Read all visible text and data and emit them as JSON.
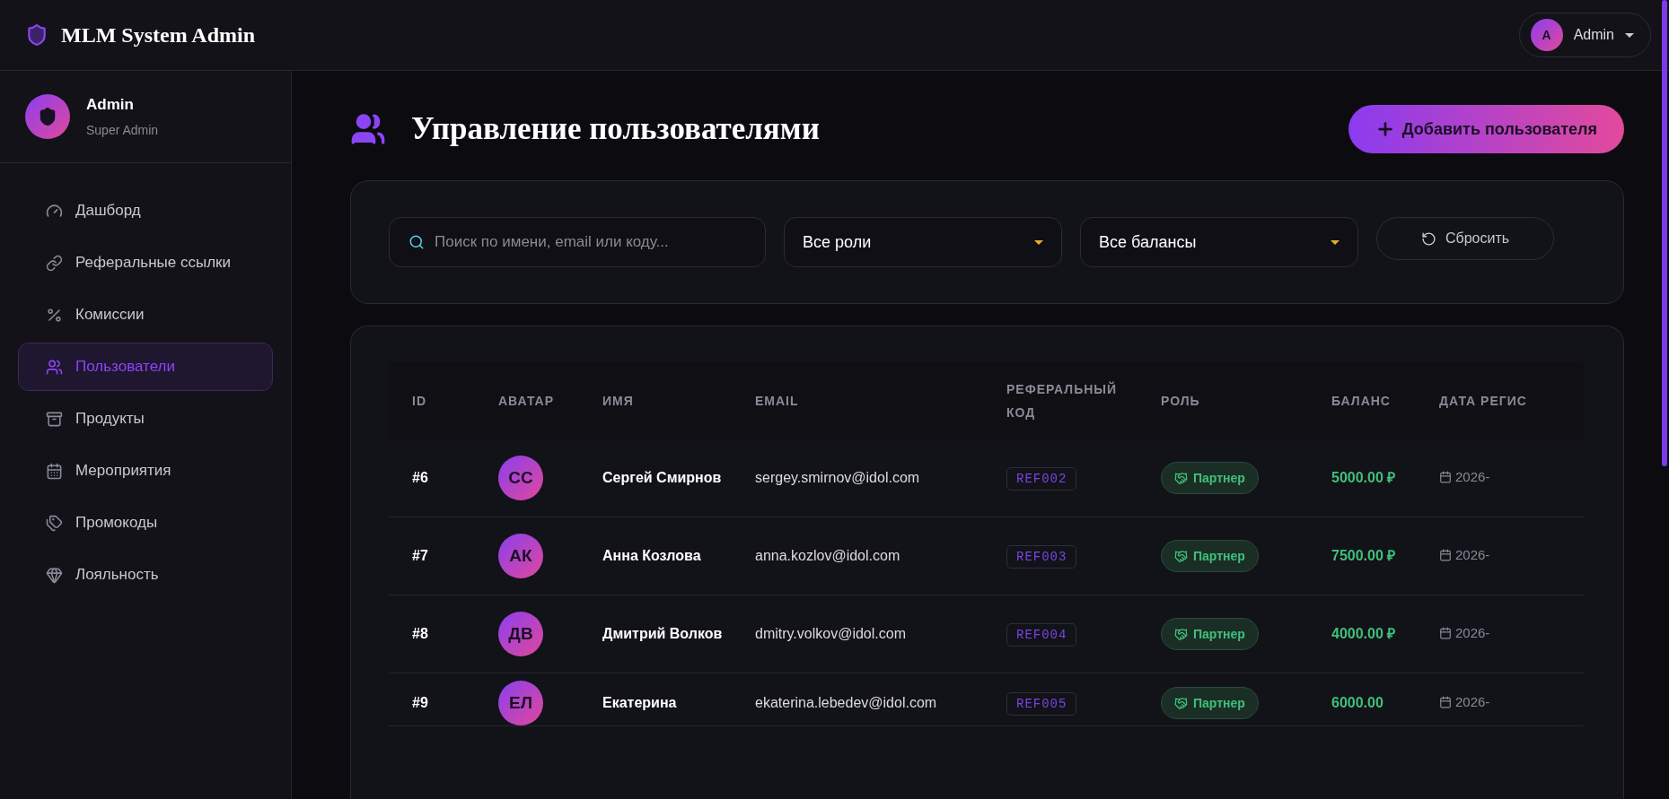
{
  "header": {
    "title": "MLM System Admin",
    "user_initial": "A",
    "user_name": "Admin"
  },
  "sidebar": {
    "profile": {
      "name": "Admin",
      "role": "Super Admin"
    },
    "items": [
      {
        "label": "Дашборд",
        "selected": false
      },
      {
        "label": "Реферальные ссылки",
        "selected": false
      },
      {
        "label": "Комиссии",
        "selected": false
      },
      {
        "label": "Пользователи",
        "selected": true
      },
      {
        "label": "Продукты",
        "selected": false
      },
      {
        "label": "Мероприятия",
        "selected": false
      },
      {
        "label": "Промокоды",
        "selected": false
      },
      {
        "label": "Лояльность",
        "selected": false
      }
    ]
  },
  "page": {
    "title": "Управление пользователями",
    "add_button": "Добавить пользователя"
  },
  "filters": {
    "search": {
      "placeholder": "Поиск по имени, email или коду..."
    },
    "role": "Все роли",
    "balance": "Все балансы",
    "reset": "Сбросить"
  },
  "table": {
    "columns": [
      "ID",
      "АВАТАР",
      "ИМЯ",
      "EMAIL",
      "РЕФЕРАЛЬНЫЙ КОД",
      "РОЛЬ",
      "БАЛАНС",
      "ДАТА РЕГИС"
    ],
    "rows": [
      {
        "id": "#6",
        "initials": "СС",
        "name": "Сергей Смирнов",
        "email": "sergey.smirnov@idol.com",
        "ref": "REF002",
        "role": "Партнер",
        "balance": "5000.00 ₽",
        "date": "2026-"
      },
      {
        "id": "#7",
        "initials": "АК",
        "name": "Анна Козлова",
        "email": "anna.kozlov@idol.com",
        "ref": "REF003",
        "role": "Партнер",
        "balance": "7500.00 ₽",
        "date": "2026-"
      },
      {
        "id": "#8",
        "initials": "ДВ",
        "name": "Дмитрий Волков",
        "email": "dmitry.volkov@idol.com",
        "ref": "REF004",
        "role": "Партнер",
        "balance": "4000.00 ₽",
        "date": "2026-"
      },
      {
        "id": "#9",
        "initials": "ЕЛ",
        "name": "Екатерина",
        "email": "ekaterina.lebedev@idol.com",
        "ref": "REF005",
        "role": "Партнер",
        "balance": "6000.00",
        "date": "2026-"
      }
    ]
  }
}
